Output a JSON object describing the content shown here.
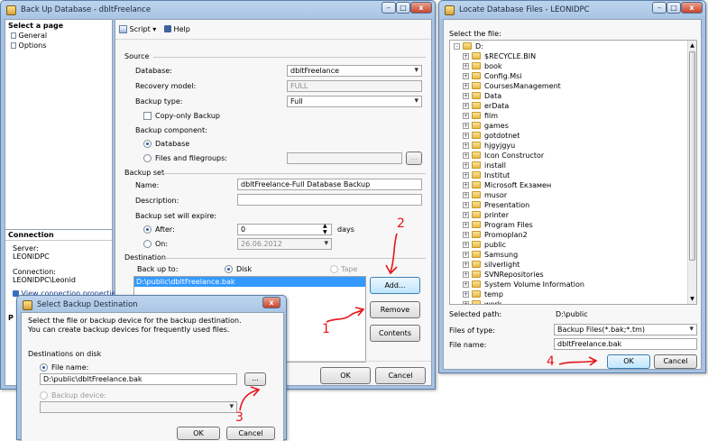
{
  "backup": {
    "title": "Back Up Database - dbltFreelance",
    "select_page": "Select a page",
    "pages": [
      "General",
      "Options"
    ],
    "toolbar": {
      "script": "Script",
      "help": "Help"
    },
    "source": {
      "heading": "Source",
      "database_label": "Database:",
      "database_value": "dbltFreelance",
      "recovery_label": "Recovery model:",
      "recovery_value": "FULL",
      "type_label": "Backup type:",
      "type_value": "Full",
      "copy_only": "Copy-only Backup",
      "component_label": "Backup component:",
      "component_database": "Database",
      "component_files": "Files and filegroups:",
      "browse": "..."
    },
    "backup_set": {
      "heading": "Backup set",
      "name_label": "Name:",
      "name_value": "dbltFreelance-Full Database Backup",
      "desc_label": "Description:",
      "expire_label": "Backup set will expire:",
      "after_label": "After:",
      "after_value": "0",
      "days": "days",
      "on_label": "On:",
      "on_value": "26.06.2012"
    },
    "destination": {
      "heading": "Destination",
      "backup_to": "Back up to:",
      "disk": "Disk",
      "tape": "Tape",
      "path": "D:\\public\\dbltFreelance.bak",
      "add": "Add...",
      "remove": "Remove",
      "contents": "Contents"
    },
    "connection": {
      "heading": "Connection",
      "server_label": "Server:",
      "server_value": "LEONIDPC",
      "conn_label": "Connection:",
      "conn_value": "LEONIDPC\\Leonid",
      "view_props": "View connection properties",
      "progress_letter": "P"
    },
    "ok": "OK",
    "cancel": "Cancel"
  },
  "select_dest": {
    "title": "Select Backup Destination",
    "description": "Select the file or backup device for the backup destination. You can create backup devices for frequently used files.",
    "dest_label": "Destinations on disk",
    "file_name_label": "File name:",
    "file_name_value": "D:\\public\\dbltFreelance.bak",
    "browse": "...",
    "device_label": "Backup device:",
    "ok": "OK",
    "cancel": "Cancel"
  },
  "locate": {
    "title": "Locate Database Files - LEONIDPC",
    "select_file": "Select the file:",
    "root": "D:",
    "folders": [
      "$RECYCLE.BIN",
      "book",
      "Config.Msi",
      "CoursesManagement",
      "Data",
      "erData",
      "film",
      "games",
      "gotdotnet",
      "hjgyjgyu",
      "Icon Constructor",
      "install",
      "Institut",
      "Microsoft Екзамен",
      "musor",
      "Presentation",
      "printer",
      "Program Files",
      "Promoplan2",
      "public",
      "Samsung",
      "silverlight",
      "SVNRepositories",
      "System Volume Information",
      "temp",
      "work"
    ],
    "selected_path_label": "Selected path:",
    "selected_path_value": "D:\\public",
    "files_type_label": "Files of type:",
    "files_type_value": "Backup Files(*.bak;*.tm)",
    "file_name_label": "File name:",
    "file_name_value": "dbltFreelance.bak",
    "ok": "OK",
    "cancel": "Cancel"
  },
  "annotations": [
    "1",
    "2",
    "3",
    "4"
  ],
  "colors": {
    "annotation": "#e8141a",
    "title_bar": "#a7c2e2",
    "selection": "#3399ff"
  }
}
